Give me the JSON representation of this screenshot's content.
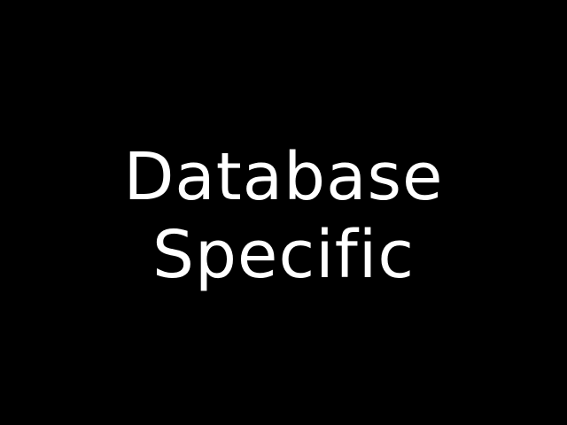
{
  "slide": {
    "title_lines": [
      "Database",
      "Specific"
    ]
  },
  "colors": {
    "background": "#000000",
    "text": "#ffffff"
  }
}
